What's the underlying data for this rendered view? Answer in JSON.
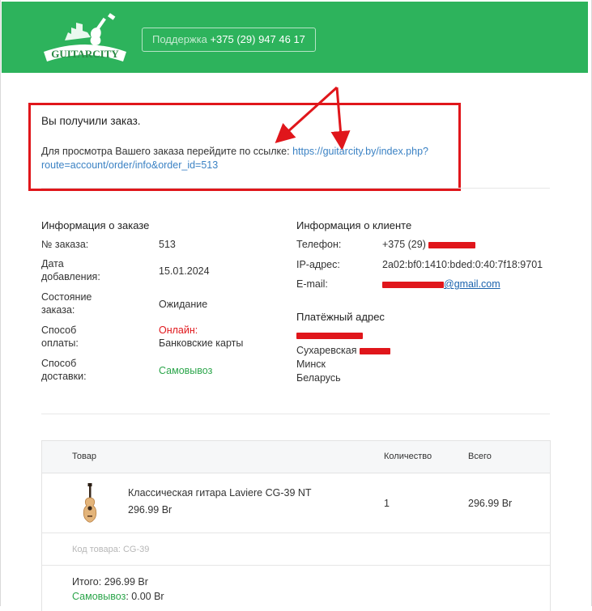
{
  "header": {
    "logo_text": "GUITARCITY",
    "support_label": "Поддержка",
    "support_phone": "+375 (29) 947 46 17"
  },
  "notice": {
    "title": "Вы получили заказ.",
    "text": "Для просмотра Вашего заказа перейдите по ссылке:",
    "link_line1": "https://guitarcity.by/index.php?",
    "link_line2": "route=account/order/info&order_id=513"
  },
  "order_info": {
    "heading": "Информация о заказе",
    "order_no_label": "№ заказа:",
    "order_no": "513",
    "date_label_1": "Дата",
    "date_label_2": "добавления:",
    "date": "15.01.2024",
    "status_label_1": "Состояние",
    "status_label_2": "заказа:",
    "status": "Ожидание",
    "payment_label_1": "Способ",
    "payment_label_2": "оплаты:",
    "payment_line1": "Онлайн:",
    "payment_line2": "Банковские карты",
    "shipping_label_1": "Способ",
    "shipping_label_2": "доставки:",
    "shipping": "Самовывоз"
  },
  "client_info": {
    "heading": "Информация о клиенте",
    "phone_label": "Телефон:",
    "phone_prefix": "+375 (29)",
    "ip_label": "IP-адрес:",
    "ip": "2a02:bf0:1410:bded:0:40:7f18:9701",
    "email_label": "E-mail:",
    "email_domain": "@gmail.com",
    "payment_address_heading": "Платёжный адрес",
    "street": "Сухаревская",
    "city": "Минск",
    "country": "Беларусь"
  },
  "table": {
    "col_product": "Товар",
    "col_qty": "Количество",
    "col_total": "Всего",
    "items": [
      {
        "name": "Классическая гитара Laviere CG-39 NT",
        "price": "296.99 Br",
        "qty": "1",
        "total": "296.99 Br"
      }
    ],
    "code_label": "Код товара:",
    "code": "CG-39",
    "totals_label": "Итого:",
    "totals_value": "296.99 Br",
    "pickup_label": "Самовывоз",
    "pickup_value": ": 0.00 Br"
  },
  "colors": {
    "header_green": "#2db35c",
    "annotation_red": "#e0161b",
    "link_blue": "#3b82c4"
  }
}
